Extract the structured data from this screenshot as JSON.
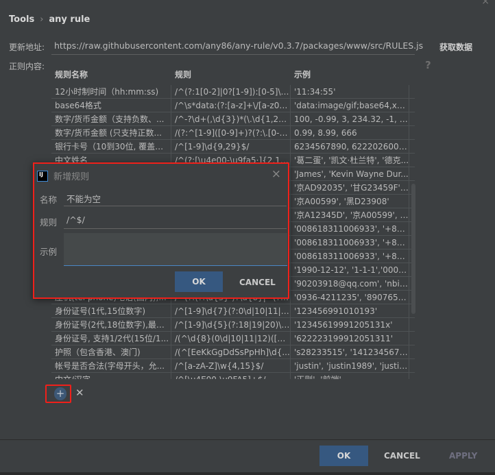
{
  "breadcrumb": {
    "root": "Tools",
    "separator": "›",
    "current": "any rule"
  },
  "url_label": "更新地址:",
  "url_value": "https://raw.githubusercontent.com/any86/any-rule/v0.3.7/packages/www/src/RULES.js",
  "fetch_label": "获取数据",
  "content_label": "正则内容:",
  "help": "?",
  "table": {
    "headers": [
      "规则名称",
      "规则",
      "示例"
    ],
    "rows": [
      [
        "12小时制时间（hh:mm:ss)",
        "/^(?:1[0-2]|0?[1-9]):[0-5]\\d:...",
        "'11:34:55'"
      ],
      [
        "base64格式",
        "/^\\s*data:(?:[a-z]+\\/[a-z0-...",
        "'data:image/gif;base64,xxx..."
      ],
      [
        "数字/货币金额（支持负数、...",
        "/^-?\\d+(,\\d{3})*(\\.\\d{1,2})?$/",
        "100, -0.99, 3, 234.32, -1, 9..."
      ],
      [
        "数字/货币金额 (只支持正数...",
        "/(?:^[1-9]([0-9]+)?(?:\\.[0-9]...",
        "0.99, 8.99, 666"
      ],
      [
        "银行卡号（10到30位, 覆盖对...",
        "/^[1-9]\\d{9,29}$/",
        "6234567890, 62220260067..."
      ],
      [
        "中文姓名",
        "/^(?:[\\u4e00-\\u9fa5·]{2,16})...",
        "'葛二蛋', '凯文·杜兰特', '德克..."
      ],
      [
        "",
        "",
        "'James', 'Kevin Wayne Dur..."
      ],
      [
        "",
        "",
        "'京AD92035', '甘G23459F', ..."
      ],
      [
        "",
        "",
        "'京A00599', '黑D23908'"
      ],
      [
        "",
        "",
        "'京A12345D', '京A00599', '..."
      ],
      [
        "",
        "",
        "'008618311006933', '+861..."
      ],
      [
        "",
        "",
        "'008618311006933', '+861..."
      ],
      [
        "",
        "",
        "'008618311006933', '+861..."
      ],
      [
        "",
        "",
        "'1990-12-12', '1-1-1','0000..."
      ],
      [
        "",
        "",
        "'90203918@qq.com', 'nbill..."
      ],
      [
        "座机(tel phone)电话(国内),...",
        "/^(?:(?:\\d{3}-)?\\d{8}|^(?:\\d{...",
        "'0936-4211235', '89076543..."
      ],
      [
        "身份证号(1代,15位数字)",
        "/^[1-9]\\d{7}(?:0\\d|10|11|12...",
        "'123456991010193'"
      ],
      [
        "身份证号(2代,18位数字),最后...",
        "/^[1-9]\\d{5}(?:18|19|20)\\d{...",
        "'12345619991205131x'"
      ],
      [
        "身份证号, 支持1/2代(15位/1...",
        "/(^\\d{8}(0\\d|10|11|12)([0-2...",
        "'622223199912051311'"
      ],
      [
        "护照（包含香港、澳门)",
        "/(^[EeKkGgDdSsPpHh]\\d{...",
        "'s28233515', '141234567', '..."
      ],
      [
        "帐号是否合法(字母开头，允...",
        "/^[a-zA-Z]\\w{4,15}$/",
        "'justin', 'justin1989', 'justin_..."
      ],
      [
        "中文/汉字",
        "/^[\\u4E00-\\u9FA5]+$/",
        "'正则', '前端'"
      ]
    ]
  },
  "dialog": {
    "title": "新增规则",
    "close": "×",
    "name_label": "名称",
    "name_value": "不能为空",
    "rule_label": "规则",
    "rule_value": "/^$/",
    "example_label": "示例",
    "example_value": "",
    "ok": "OK",
    "cancel": "CANCEL"
  },
  "toolbar": {
    "add": "+",
    "remove": "✕"
  },
  "footer": {
    "ok": "OK",
    "cancel": "CANCEL",
    "apply": "APPLY"
  },
  "colors": {
    "background": "#3c3f41",
    "primary_button": "#365880",
    "highlight": "#f0201a"
  }
}
